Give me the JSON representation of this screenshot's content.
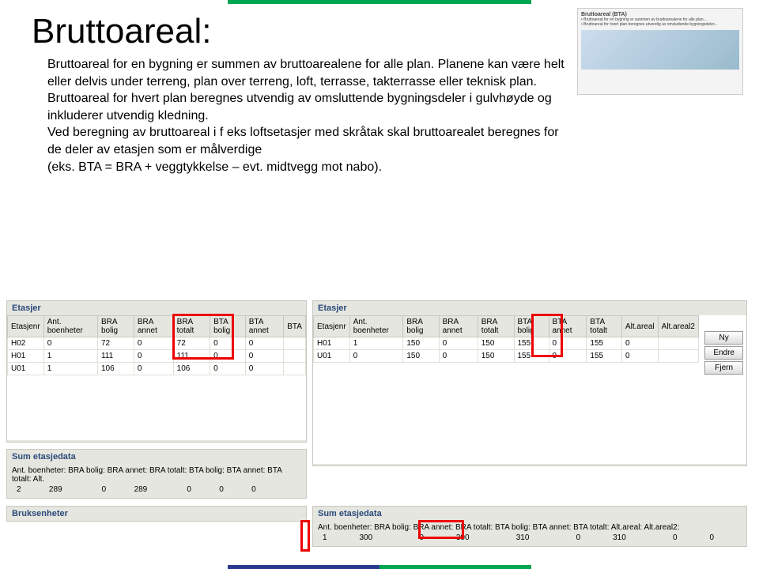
{
  "title": "Bruttoareal:",
  "desc_p1": "Bruttoareal for en bygning er summen av bruttoarealene for alle plan. Planene kan være helt eller delvis under terreng, plan over terreng, loft, terrasse, takterrasse eller teknisk plan.",
  "desc_p2": "Bruttoareal for hvert plan beregnes utvendig av omsluttende bygningsdeler i gulvhøyde og inkluderer utvendig kledning.",
  "desc_p3": "Ved beregning av bruttoareal i f eks loftsetasjer med skråtak skal bruttoarealet beregnes for de deler av etasjen som er målverdige",
  "desc_p4": "(eks. BTA = BRA + veggtykkelse – evt. midtvegg mot nabo).",
  "thumb": {
    "title": "Bruttoareal (BTA)"
  },
  "left_panel": {
    "title": "Etasjer",
    "headers": [
      "Etasjenr",
      "Ant. boenheter",
      "BRA bolig",
      "BRA annet",
      "BRA totalt",
      "BTA bolig",
      "BTA annet",
      "BTA"
    ],
    "rows": [
      [
        "H02",
        "0",
        "72",
        "0",
        "72",
        "0",
        "0",
        ""
      ],
      [
        "H01",
        "1",
        "111",
        "0",
        "111",
        "0",
        "0",
        ""
      ],
      [
        "U01",
        "1",
        "106",
        "0",
        "106",
        "0",
        "0",
        ""
      ]
    ]
  },
  "right_panel": {
    "title": "Etasjer",
    "headers": [
      "Etasjenr",
      "Ant. boenheter",
      "BRA bolig",
      "BRA annet",
      "BRA totalt",
      "BTA bolig",
      "BTA annet",
      "BTA totalt",
      "Alt.areal",
      "Alt.areal2"
    ],
    "rows": [
      [
        "H01",
        "1",
        "150",
        "0",
        "150",
        "155",
        "0",
        "155",
        "0",
        ""
      ],
      [
        "U01",
        "0",
        "150",
        "0",
        "150",
        "155",
        "0",
        "155",
        "0",
        ""
      ]
    ]
  },
  "buttons": {
    "ny": "Ny",
    "endre": "Endre",
    "fjern": "Fjern"
  },
  "sum_left": {
    "title": "Sum etasjedata",
    "header": "Ant. boenheter: BRA bolig: BRA annet: BRA totalt: BTA bolig: BTA annet: BTA totalt: Alt.",
    "vals": [
      "2",
      "289",
      "0",
      "289",
      "0",
      "0",
      "0",
      ""
    ]
  },
  "sum_left2": {
    "title": "Bruksenheter"
  },
  "sum_right": {
    "title": "Sum etasjedata",
    "header": "Ant. boenheter: BRA bolig: BRA annet: BRA totalt: BTA bolig: BTA annet: BTA totalt: Alt.areal: Alt.areal2:",
    "vals": [
      "1",
      "300",
      "0",
      "300",
      "310",
      "0",
      "310",
      "0",
      "0"
    ]
  }
}
